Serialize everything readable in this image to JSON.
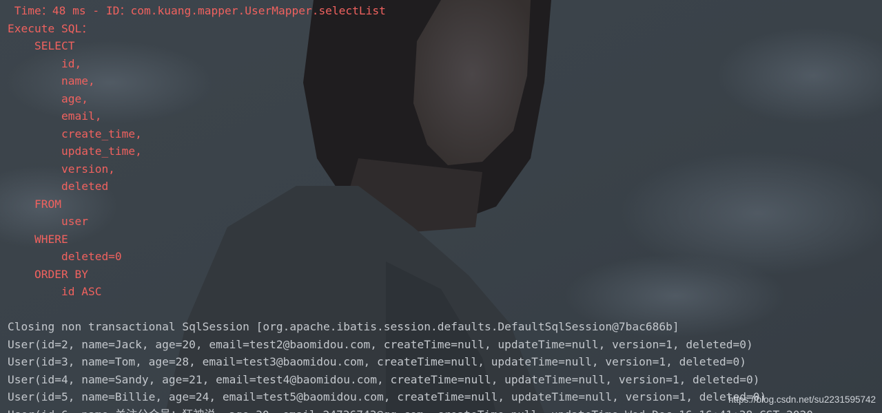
{
  "console": {
    "sql_log": [
      " Time：48 ms - ID：com.kuang.mapper.UserMapper.selectList",
      "Execute SQL：",
      "    SELECT",
      "        id,",
      "        name,",
      "        age,",
      "        email,",
      "        create_time,",
      "        update_time,",
      "        version,",
      "        deleted",
      "    FROM",
      "        user",
      "    WHERE",
      "        deleted=0",
      "    ORDER BY",
      "        id ASC"
    ],
    "output": [
      "Closing non transactional SqlSession [org.apache.ibatis.session.defaults.DefaultSqlSession@7bac686b]",
      "User(id=2, name=Jack, age=20, email=test2@baomidou.com, createTime=null, updateTime=null, version=1, deleted=0)",
      "User(id=3, name=Tom, age=28, email=test3@baomidou.com, createTime=null, updateTime=null, version=1, deleted=0)",
      "User(id=4, name=Sandy, age=21, email=test4@baomidou.com, createTime=null, updateTime=null, version=1, deleted=0)",
      "User(id=5, name=Billie, age=24, email=test5@baomidou.com, createTime=null, updateTime=null, version=1, deleted=0)",
      "User(id=6, name=关注公众号：狂神说, age=30, email=24736743@qq.com, createTime=null, updateTime=Wed Dec 16 16:41:38 CST 2020"
    ]
  },
  "watermark": "https://blog.csdn.net/su2231595742",
  "colors": {
    "sql_text": "#f0625f",
    "output_text": "#c4c8cd",
    "background": "#3b434b"
  }
}
